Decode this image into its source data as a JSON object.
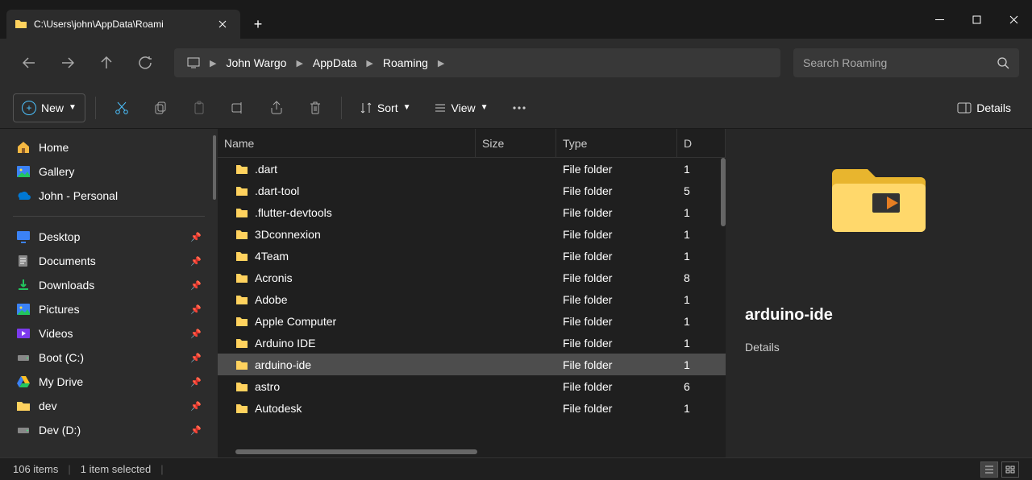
{
  "tab": {
    "title": "C:\\Users\\john\\AppData\\Roami"
  },
  "breadcrumb": [
    "John Wargo",
    "AppData",
    "Roaming"
  ],
  "search": {
    "placeholder": "Search Roaming"
  },
  "toolbar": {
    "new": "New",
    "sort": "Sort",
    "view": "View",
    "details": "Details"
  },
  "sidebar": {
    "top": [
      {
        "label": "Home",
        "icon": "home"
      },
      {
        "label": "Gallery",
        "icon": "gallery"
      },
      {
        "label": "John - Personal",
        "icon": "onedrive"
      }
    ],
    "pinned": [
      {
        "label": "Desktop",
        "icon": "desktop"
      },
      {
        "label": "Documents",
        "icon": "documents"
      },
      {
        "label": "Downloads",
        "icon": "downloads"
      },
      {
        "label": "Pictures",
        "icon": "pictures"
      },
      {
        "label": "Videos",
        "icon": "videos"
      },
      {
        "label": "Boot (C:)",
        "icon": "drive"
      },
      {
        "label": "My Drive",
        "icon": "gdrive"
      },
      {
        "label": "dev",
        "icon": "folder"
      },
      {
        "label": "Dev (D:)",
        "icon": "drive"
      }
    ]
  },
  "columns": {
    "name": "Name",
    "size": "Size",
    "type": "Type",
    "date": "D"
  },
  "files": [
    {
      "name": ".dart",
      "type": "File folder",
      "date": "1"
    },
    {
      "name": ".dart-tool",
      "type": "File folder",
      "date": "5"
    },
    {
      "name": ".flutter-devtools",
      "type": "File folder",
      "date": "1"
    },
    {
      "name": "3Dconnexion",
      "type": "File folder",
      "date": "1"
    },
    {
      "name": "4Team",
      "type": "File folder",
      "date": "1"
    },
    {
      "name": "Acronis",
      "type": "File folder",
      "date": "8"
    },
    {
      "name": "Adobe",
      "type": "File folder",
      "date": "1"
    },
    {
      "name": "Apple Computer",
      "type": "File folder",
      "date": "1"
    },
    {
      "name": "Arduino IDE",
      "type": "File folder",
      "date": "1"
    },
    {
      "name": "arduino-ide",
      "type": "File folder",
      "date": "1",
      "selected": true
    },
    {
      "name": "astro",
      "type": "File folder",
      "date": "6"
    },
    {
      "name": "Autodesk",
      "type": "File folder",
      "date": "1"
    }
  ],
  "details": {
    "name": "arduino-ide",
    "heading": "Details"
  },
  "status": {
    "count": "106 items",
    "selection": "1 item selected"
  }
}
